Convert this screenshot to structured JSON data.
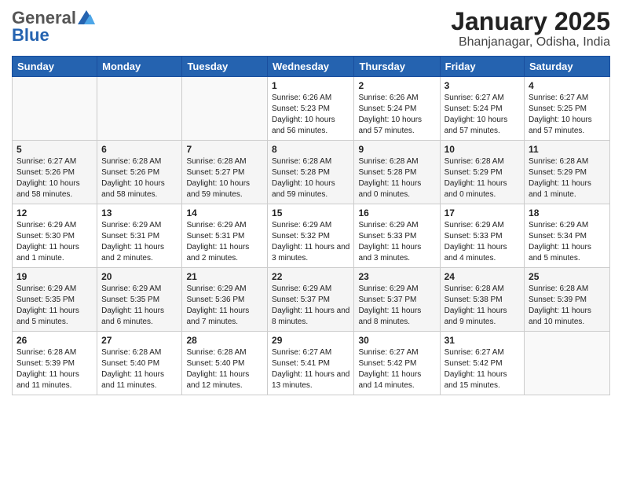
{
  "header": {
    "logo_general": "General",
    "logo_blue": "Blue",
    "main_title": "January 2025",
    "subtitle": "Bhanjanagar, Odisha, India"
  },
  "days_of_week": [
    "Sunday",
    "Monday",
    "Tuesday",
    "Wednesday",
    "Thursday",
    "Friday",
    "Saturday"
  ],
  "weeks": [
    [
      {
        "day": "",
        "info": ""
      },
      {
        "day": "",
        "info": ""
      },
      {
        "day": "",
        "info": ""
      },
      {
        "day": "1",
        "info": "Sunrise: 6:26 AM\nSunset: 5:23 PM\nDaylight: 10 hours and 56 minutes."
      },
      {
        "day": "2",
        "info": "Sunrise: 6:26 AM\nSunset: 5:24 PM\nDaylight: 10 hours and 57 minutes."
      },
      {
        "day": "3",
        "info": "Sunrise: 6:27 AM\nSunset: 5:24 PM\nDaylight: 10 hours and 57 minutes."
      },
      {
        "day": "4",
        "info": "Sunrise: 6:27 AM\nSunset: 5:25 PM\nDaylight: 10 hours and 57 minutes."
      }
    ],
    [
      {
        "day": "5",
        "info": "Sunrise: 6:27 AM\nSunset: 5:26 PM\nDaylight: 10 hours and 58 minutes."
      },
      {
        "day": "6",
        "info": "Sunrise: 6:28 AM\nSunset: 5:26 PM\nDaylight: 10 hours and 58 minutes."
      },
      {
        "day": "7",
        "info": "Sunrise: 6:28 AM\nSunset: 5:27 PM\nDaylight: 10 hours and 59 minutes."
      },
      {
        "day": "8",
        "info": "Sunrise: 6:28 AM\nSunset: 5:28 PM\nDaylight: 10 hours and 59 minutes."
      },
      {
        "day": "9",
        "info": "Sunrise: 6:28 AM\nSunset: 5:28 PM\nDaylight: 11 hours and 0 minutes."
      },
      {
        "day": "10",
        "info": "Sunrise: 6:28 AM\nSunset: 5:29 PM\nDaylight: 11 hours and 0 minutes."
      },
      {
        "day": "11",
        "info": "Sunrise: 6:28 AM\nSunset: 5:29 PM\nDaylight: 11 hours and 1 minute."
      }
    ],
    [
      {
        "day": "12",
        "info": "Sunrise: 6:29 AM\nSunset: 5:30 PM\nDaylight: 11 hours and 1 minute."
      },
      {
        "day": "13",
        "info": "Sunrise: 6:29 AM\nSunset: 5:31 PM\nDaylight: 11 hours and 2 minutes."
      },
      {
        "day": "14",
        "info": "Sunrise: 6:29 AM\nSunset: 5:31 PM\nDaylight: 11 hours and 2 minutes."
      },
      {
        "day": "15",
        "info": "Sunrise: 6:29 AM\nSunset: 5:32 PM\nDaylight: 11 hours and 3 minutes."
      },
      {
        "day": "16",
        "info": "Sunrise: 6:29 AM\nSunset: 5:33 PM\nDaylight: 11 hours and 3 minutes."
      },
      {
        "day": "17",
        "info": "Sunrise: 6:29 AM\nSunset: 5:33 PM\nDaylight: 11 hours and 4 minutes."
      },
      {
        "day": "18",
        "info": "Sunrise: 6:29 AM\nSunset: 5:34 PM\nDaylight: 11 hours and 5 minutes."
      }
    ],
    [
      {
        "day": "19",
        "info": "Sunrise: 6:29 AM\nSunset: 5:35 PM\nDaylight: 11 hours and 5 minutes."
      },
      {
        "day": "20",
        "info": "Sunrise: 6:29 AM\nSunset: 5:35 PM\nDaylight: 11 hours and 6 minutes."
      },
      {
        "day": "21",
        "info": "Sunrise: 6:29 AM\nSunset: 5:36 PM\nDaylight: 11 hours and 7 minutes."
      },
      {
        "day": "22",
        "info": "Sunrise: 6:29 AM\nSunset: 5:37 PM\nDaylight: 11 hours and 8 minutes."
      },
      {
        "day": "23",
        "info": "Sunrise: 6:29 AM\nSunset: 5:37 PM\nDaylight: 11 hours and 8 minutes."
      },
      {
        "day": "24",
        "info": "Sunrise: 6:28 AM\nSunset: 5:38 PM\nDaylight: 11 hours and 9 minutes."
      },
      {
        "day": "25",
        "info": "Sunrise: 6:28 AM\nSunset: 5:39 PM\nDaylight: 11 hours and 10 minutes."
      }
    ],
    [
      {
        "day": "26",
        "info": "Sunrise: 6:28 AM\nSunset: 5:39 PM\nDaylight: 11 hours and 11 minutes."
      },
      {
        "day": "27",
        "info": "Sunrise: 6:28 AM\nSunset: 5:40 PM\nDaylight: 11 hours and 11 minutes."
      },
      {
        "day": "28",
        "info": "Sunrise: 6:28 AM\nSunset: 5:40 PM\nDaylight: 11 hours and 12 minutes."
      },
      {
        "day": "29",
        "info": "Sunrise: 6:27 AM\nSunset: 5:41 PM\nDaylight: 11 hours and 13 minutes."
      },
      {
        "day": "30",
        "info": "Sunrise: 6:27 AM\nSunset: 5:42 PM\nDaylight: 11 hours and 14 minutes."
      },
      {
        "day": "31",
        "info": "Sunrise: 6:27 AM\nSunset: 5:42 PM\nDaylight: 11 hours and 15 minutes."
      },
      {
        "day": "",
        "info": ""
      }
    ]
  ]
}
